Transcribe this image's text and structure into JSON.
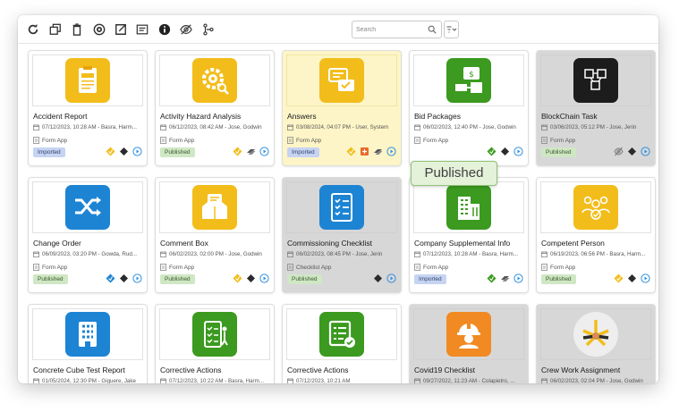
{
  "toolbar": {
    "tools": [
      {
        "icon": "refresh-icon"
      },
      {
        "icon": "copy-icon"
      },
      {
        "icon": "delete-icon"
      },
      {
        "icon": "publish-icon"
      },
      {
        "icon": "export-icon"
      },
      {
        "icon": "card-view-icon"
      },
      {
        "icon": "info-icon"
      },
      {
        "icon": "hide-icon"
      },
      {
        "icon": "workflow-icon"
      }
    ],
    "search_placeholder": "Search",
    "search_value": ""
  },
  "colors": {
    "yellow_icon": "#f2bd1b",
    "blue_icon": "#1d84d4",
    "green_icon": "#3b9a1f",
    "orange_icon": "#f18a22",
    "dark_icon": "#1c1c1c",
    "selected_card": "#fdf5c7",
    "disabled_card": "#d7d7d7",
    "imported_badge": "#c6d4f2",
    "published_badge": "#cfe7c4"
  },
  "apps": [
    {
      "title": "Accident Report",
      "meta": "07/12/2023, 10:28 AM - Basra, Harm...",
      "type": "Form App",
      "status": "Imported",
      "icon": "accident-report-icon",
      "tint": "yellow",
      "state": "normal",
      "badges": [
        "yellow-diamond",
        "black-diamond",
        "play"
      ]
    },
    {
      "title": "Activity Hazard Analysis",
      "meta": "06/12/2023, 08:42 AM - Jose, Godwin",
      "type": "Form App",
      "status": "Published",
      "icon": "hazard-gear-icon",
      "tint": "yellow",
      "state": "normal",
      "badges": [
        "yellow-diamond",
        "stack",
        "play"
      ]
    },
    {
      "title": "Answers",
      "meta": "03/08/2024, 04:07 PM - User, System",
      "type": "Form App",
      "status": "Imported",
      "icon": "chat-answers-icon",
      "tint": "yellow",
      "state": "selected",
      "badges": [
        "yellow-diamond",
        "orange-square",
        "stack",
        "play"
      ]
    },
    {
      "title": "Bid Packages",
      "meta": "06/02/2023, 12:40 PM - Jose, Godwin",
      "type": "Form App",
      "status": "",
      "icon": "bid-packages-icon",
      "tint": "green",
      "state": "normal",
      "badges": [
        "green-diamond",
        "black-diamond",
        "play"
      ]
    },
    {
      "title": "BlockChain Task",
      "meta": "03/06/2023, 05:12 PM - Jose, Jerin",
      "type": "Form App",
      "status": "Published",
      "icon": "blockchain-icon",
      "tint": "dark",
      "state": "disabled",
      "badges": [
        "eye-off",
        "black-diamond",
        "play"
      ]
    },
    {
      "title": "Change Order",
      "meta": "06/09/2023, 03:20 PM - Gowda, Rud...",
      "type": "Form App",
      "status": "Published",
      "icon": "shuffle-icon",
      "tint": "blue",
      "state": "normal",
      "badges": [
        "blue-diamond",
        "black-diamond",
        "play"
      ]
    },
    {
      "title": "Comment Box",
      "meta": "06/02/2023, 02:00 PM - Jose, Godwin",
      "type": "Form App",
      "status": "Published",
      "icon": "comment-box-icon",
      "tint": "yellow",
      "state": "normal",
      "badges": [
        "yellow-diamond",
        "black-diamond",
        "play"
      ]
    },
    {
      "title": "Commissioning Checklist",
      "meta": "06/02/2023, 08:45 PM - Jose, Jerin",
      "type": "Checklist App",
      "status": "Published",
      "icon": "checklist-icon",
      "tint": "blue",
      "state": "disabled",
      "badges": [
        "black-diamond",
        "play"
      ]
    },
    {
      "title": "Company Supplemental Info",
      "meta": "07/12/2023, 10:28 AM - Basra, Harm...",
      "type": "Form App",
      "status": "Imported",
      "icon": "building-icon",
      "tint": "green",
      "state": "normal",
      "badges": [
        "green-diamond",
        "stack",
        "play"
      ]
    },
    {
      "title": "Competent Person",
      "meta": "06/19/2023, 06:56 PM - Basra, Harm...",
      "type": "Form App",
      "status": "Published",
      "icon": "team-icon",
      "tint": "yellow",
      "state": "normal",
      "badges": [
        "yellow-diamond",
        "black-diamond",
        "play"
      ]
    },
    {
      "title": "Concrete Cube Test Report",
      "meta": "01/05/2024, 12:30 PM - Giguere, Jake",
      "type": "",
      "status": "",
      "icon": "concrete-cube-icon",
      "tint": "blue",
      "state": "normal",
      "badges": []
    },
    {
      "title": "Corrective Actions",
      "meta": "07/12/2023, 10:22 AM - Basra, Harm...",
      "type": "",
      "status": "",
      "icon": "corrective-actions-icon",
      "tint": "green",
      "state": "normal",
      "badges": []
    },
    {
      "title": "Corrective Actions",
      "meta": "07/12/2023, 10:21 AM",
      "type": "",
      "status": "",
      "icon": "corrective-list-icon",
      "tint": "green",
      "state": "normal",
      "badges": []
    },
    {
      "title": "Covid19 Checklist",
      "meta": "09/27/2022, 11:23 AM - Colapietro, ...",
      "type": "",
      "status": "",
      "icon": "worker-helmet-icon",
      "tint": "orange",
      "state": "disabled",
      "badges": []
    },
    {
      "title": "Crew Work Assignment",
      "meta": "06/02/2023, 02:04 PM - Jose, Godwin",
      "type": "",
      "status": "",
      "icon": "crew-hands-icon",
      "tint": "round",
      "state": "disabled",
      "badges": []
    }
  ],
  "tooltip": {
    "text": "Published"
  }
}
